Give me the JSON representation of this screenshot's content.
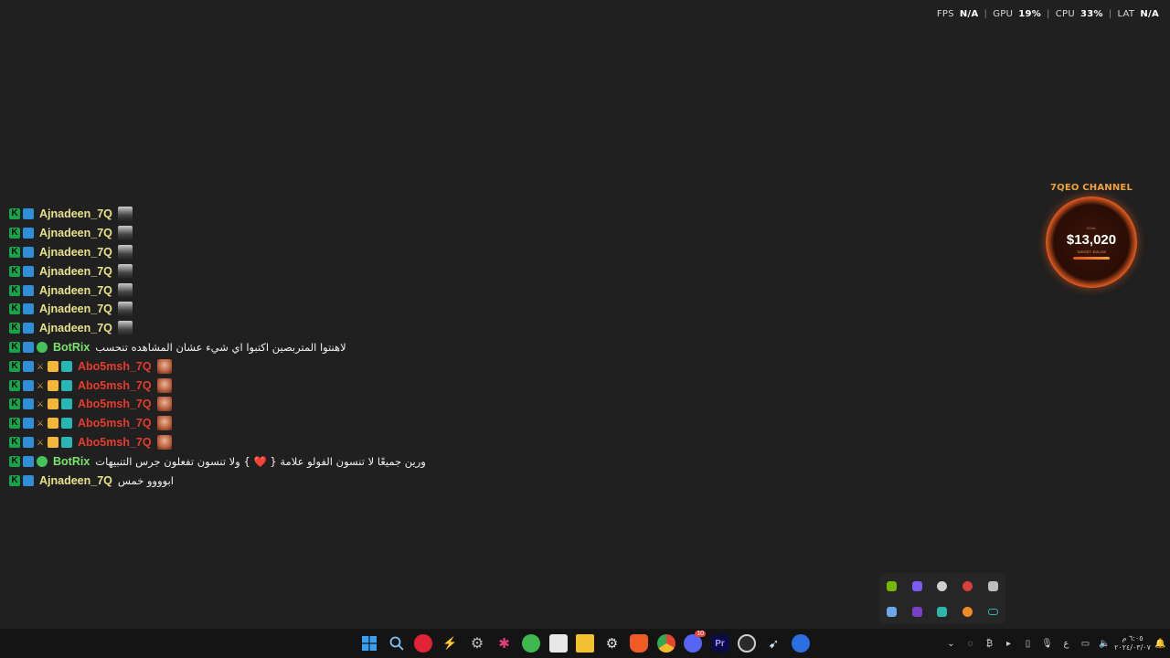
{
  "perf_overlay": {
    "fps_label": "FPS",
    "fps_value": "N/A",
    "gpu_label": "GPU",
    "gpu_value": "19%",
    "cpu_label": "CPU",
    "cpu_value": "33%",
    "lat_label": "LAT",
    "lat_value": "N/A",
    "separator": "|"
  },
  "chat": {
    "messages": [
      {
        "user": "Ajnadeen_7Q",
        "text": ""
      },
      {
        "user": "Ajnadeen_7Q",
        "text": ""
      },
      {
        "user": "Ajnadeen_7Q",
        "text": ""
      },
      {
        "user": "Ajnadeen_7Q",
        "text": ""
      },
      {
        "user": "Ajnadeen_7Q",
        "text": ""
      },
      {
        "user": "Ajnadeen_7Q",
        "text": ""
      },
      {
        "user": "Ajnadeen_7Q",
        "text": ""
      },
      {
        "user": "BotRix",
        "text": "لاهنتوا المتربصين اكتبوا اي شيء عشان المشاهده تنحسب"
      },
      {
        "user": "Abo5msh_7Q",
        "text": ""
      },
      {
        "user": "Abo5msh_7Q",
        "text": ""
      },
      {
        "user": "Abo5msh_7Q",
        "text": ""
      },
      {
        "user": "Abo5msh_7Q",
        "text": ""
      },
      {
        "user": "Abo5msh_7Q",
        "text": ""
      },
      {
        "user": "BotRix",
        "text_before": "ورين جميعًا لا تنسون الفولو علامة {",
        "heart": "❤️",
        "text_after": "} ولا تنسون تفعلون جرس التنبيهات"
      },
      {
        "user": "Ajnadeen_7Q",
        "text": "ابوووو خمس"
      }
    ]
  },
  "goal_widget": {
    "title": "7QEO CHANNEL",
    "small_label": "GOAL",
    "amount": "$13,020",
    "target": "TARGET: $15,000"
  },
  "tray_flyout": {
    "icons": [
      "nvidia-icon",
      "grid-app-icon",
      "steelseries-icon",
      "media-icon",
      "copy-icon",
      "steam-icon",
      "onenote-icon",
      "defender-icon",
      "app-icon",
      "battery-icon"
    ]
  },
  "taskbar": {
    "apps": [
      "windows-start-icon",
      "search-icon",
      "app-red-icon",
      "bolt-icon",
      "settings-icon",
      "bug-icon",
      "green-app-icon",
      "snipping-icon",
      "file-explorer-icon",
      "steelseries-icon",
      "brave-icon",
      "chrome-icon",
      "discord-icon",
      "premiere-icon",
      "obs-icon",
      "steam-icon",
      "app-blue-icon"
    ],
    "discord_badge": "10",
    "premiere_label": "Pr",
    "lang_indicator": "ع",
    "clock_time": "٦:٠٥ م",
    "clock_date": "٢٠٢٤/٠٣/٠٧"
  },
  "colors": {
    "background": "#202020",
    "taskbar": "#141414",
    "ajnadeen": "#e8e28c",
    "botrix": "#7be36d",
    "abo5msh": "#e53c2e",
    "goal_accent": "#f2a23a"
  }
}
